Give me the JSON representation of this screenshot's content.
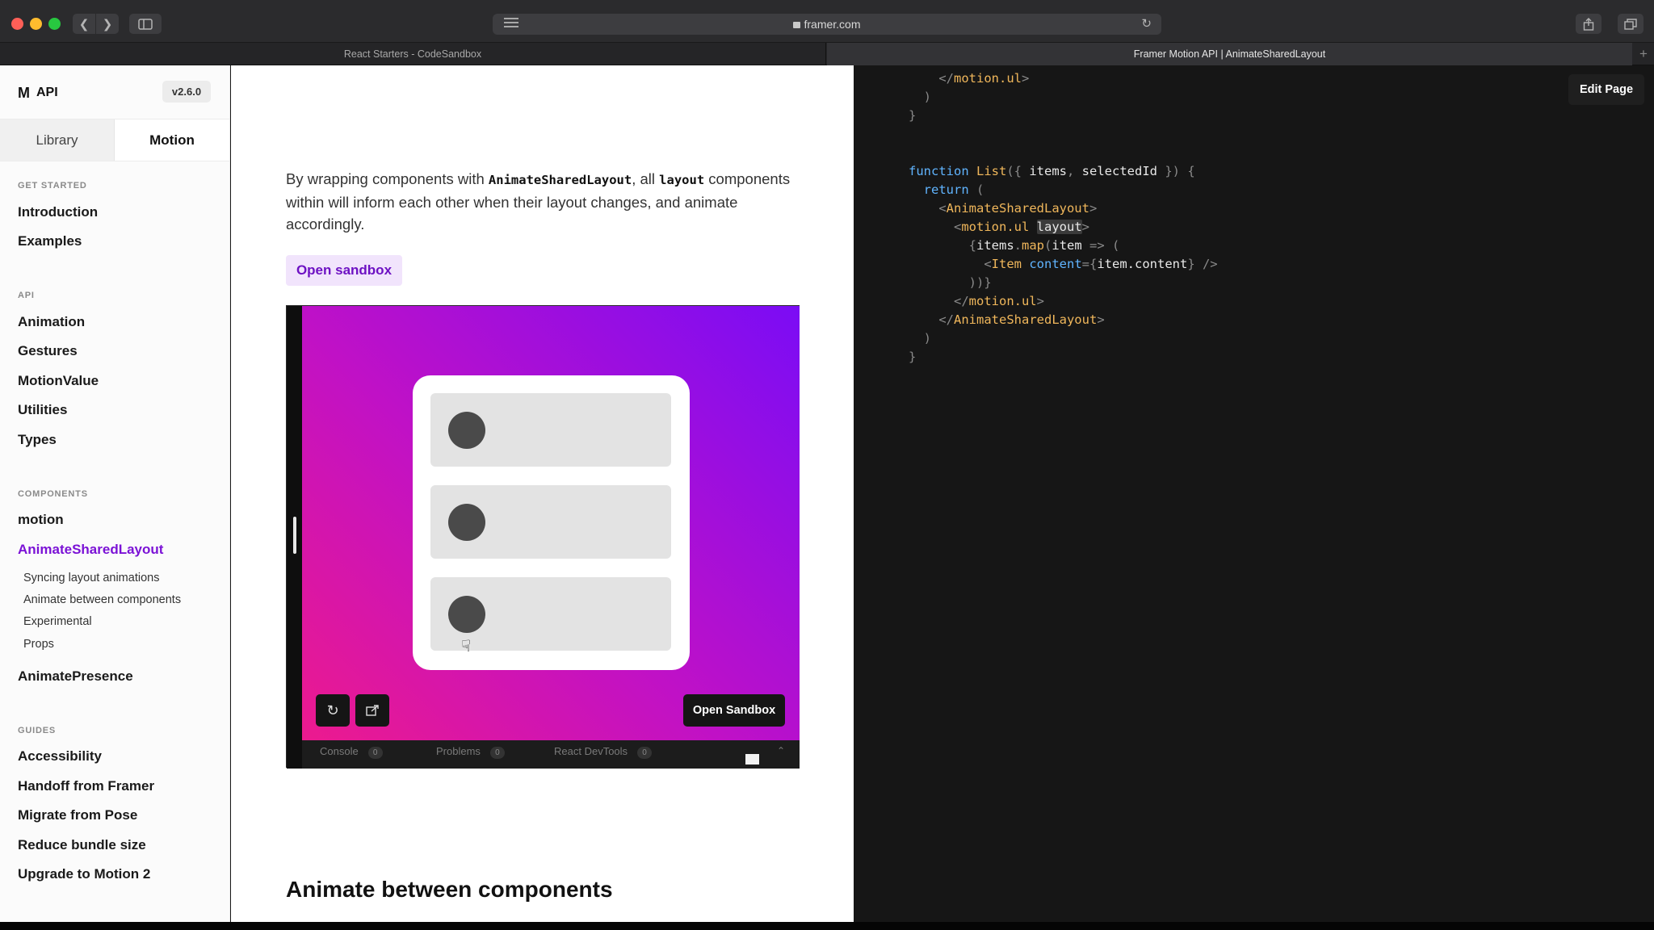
{
  "browser": {
    "url": "framer.com",
    "tabs": [
      {
        "title": "React Starters - CodeSandbox",
        "active": false
      },
      {
        "title": "Framer Motion API | AnimateSharedLayout",
        "active": true
      }
    ],
    "add_tab_glyph": "+"
  },
  "sidebar": {
    "logo_icon": "M",
    "logo_text": "API",
    "version": "v2.6.0",
    "tabs": [
      "Library",
      "Motion"
    ],
    "sections": [
      {
        "title": "GET STARTED",
        "items": [
          "Introduction",
          "Examples"
        ]
      },
      {
        "title": "API",
        "items": [
          "Animation",
          "Gestures",
          "MotionValue",
          "Utilities",
          "Types"
        ]
      },
      {
        "title": "COMPONENTS",
        "items": [
          "motion",
          "AnimateSharedLayout",
          "AnimatePresence"
        ]
      },
      {
        "title": "GUIDES",
        "items": [
          "Accessibility",
          "Handoff from Framer",
          "Migrate from Pose",
          "Reduce bundle size",
          "Upgrade to Motion 2"
        ]
      }
    ],
    "active_item": "AnimateSharedLayout",
    "sub_items": [
      "Syncing layout animations",
      "Animate between components",
      "Experimental",
      "Props"
    ]
  },
  "main": {
    "paragraph": {
      "p1": "By wrapping components with ",
      "code1": "AnimateSharedLayout",
      "p2": ", all ",
      "code2": "layout",
      "p3": " components within will inform each other when their layout changes, and animate accordingly."
    },
    "open_sandbox_label": "Open sandbox",
    "demo": {
      "open_sandbox_label": "Open Sandbox",
      "console_tabs": [
        {
          "label": "Console",
          "count": "0"
        },
        {
          "label": "Problems",
          "count": "0"
        },
        {
          "label": "React DevTools",
          "count": "0"
        }
      ]
    },
    "heading": "Animate between components"
  },
  "code_pane": {
    "edit_page_label": "Edit Page",
    "lines": [
      [
        {
          "t": "    </",
          "c": "#8a8a8a"
        },
        {
          "t": "motion.ul",
          "c": "#f0b75b"
        },
        {
          "t": ">",
          "c": "#8a8a8a"
        }
      ],
      [
        {
          "t": "  )",
          "c": "#8a8a8a"
        }
      ],
      [
        {
          "t": "}",
          "c": "#8a8a8a"
        }
      ],
      [
        {
          "t": "",
          "c": "#d4d4d4"
        }
      ],
      [
        {
          "t": "",
          "c": "#d4d4d4"
        }
      ],
      [
        {
          "t": "function ",
          "c": "#60b4ff"
        },
        {
          "t": "List",
          "c": "#f0b75b"
        },
        {
          "t": "({ ",
          "c": "#8a8a8a"
        },
        {
          "t": "items",
          "c": "#e8e8e8"
        },
        {
          "t": ", ",
          "c": "#8a8a8a"
        },
        {
          "t": "selectedId",
          "c": "#e8e8e8"
        },
        {
          "t": " }) {",
          "c": "#8a8a8a"
        }
      ],
      [
        {
          "t": "  return ",
          "c": "#60b4ff"
        },
        {
          "t": "(",
          "c": "#8a8a8a"
        }
      ],
      [
        {
          "t": "    <",
          "c": "#8a8a8a"
        },
        {
          "t": "AnimateSharedLayout",
          "c": "#f0b75b"
        },
        {
          "t": ">",
          "c": "#8a8a8a"
        }
      ],
      [
        {
          "t": "      <",
          "c": "#8a8a8a"
        },
        {
          "t": "motion.ul ",
          "c": "#f0b75b"
        },
        {
          "t": "layout",
          "c": "#e8e8e8",
          "hl": true
        },
        {
          "t": ">",
          "c": "#8a8a8a"
        }
      ],
      [
        {
          "t": "        {",
          "c": "#8a8a8a"
        },
        {
          "t": "items",
          "c": "#e8e8e8"
        },
        {
          "t": ".",
          "c": "#8a8a8a"
        },
        {
          "t": "map",
          "c": "#f0b75b"
        },
        {
          "t": "(",
          "c": "#8a8a8a"
        },
        {
          "t": "item",
          "c": "#e8e8e8"
        },
        {
          "t": " => (",
          "c": "#8a8a8a"
        }
      ],
      [
        {
          "t": "          <",
          "c": "#8a8a8a"
        },
        {
          "t": "Item ",
          "c": "#f0b75b"
        },
        {
          "t": "content",
          "c": "#60b4ff"
        },
        {
          "t": "={",
          "c": "#8a8a8a"
        },
        {
          "t": "item.content",
          "c": "#e8e8e8"
        },
        {
          "t": "} />",
          "c": "#8a8a8a"
        }
      ],
      [
        {
          "t": "        ))}",
          "c": "#8a8a8a"
        }
      ],
      [
        {
          "t": "      </",
          "c": "#8a8a8a"
        },
        {
          "t": "motion.ul",
          "c": "#f0b75b"
        },
        {
          "t": ">",
          "c": "#8a8a8a"
        }
      ],
      [
        {
          "t": "    </",
          "c": "#8a8a8a"
        },
        {
          "t": "AnimateSharedLayout",
          "c": "#f0b75b"
        },
        {
          "t": ">",
          "c": "#8a8a8a"
        }
      ],
      [
        {
          "t": "  )",
          "c": "#8a8a8a"
        }
      ],
      [
        {
          "t": "}",
          "c": "#8a8a8a"
        }
      ]
    ]
  },
  "colors": {
    "accent": "#7b12d6",
    "open_sandbox_bg": "#f1e4fc",
    "gradient_start": "#ec1a8e",
    "gradient_end": "#7b0cf5",
    "code_bg": "#161616"
  }
}
